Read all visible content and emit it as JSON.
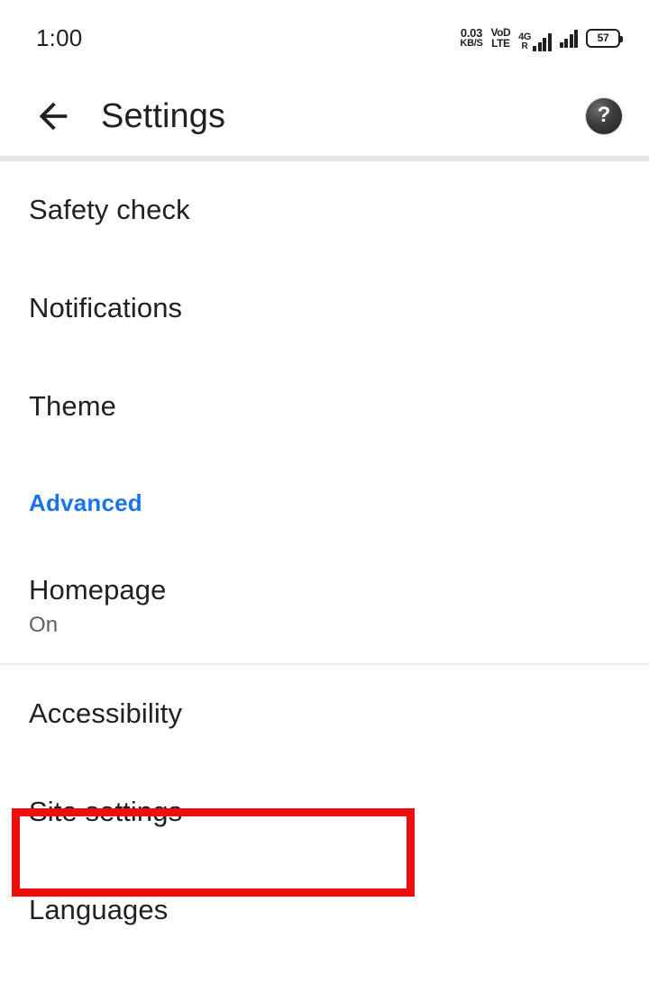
{
  "status_bar": {
    "clock": "1:00",
    "net_speed_value": "0.03",
    "net_speed_unit": "KB/S",
    "volte_top": "VoD",
    "volte_bottom": "LTE",
    "network_type": "4G",
    "roaming": "R",
    "battery_percent": "57"
  },
  "toolbar": {
    "title": "Settings",
    "back_icon": "back-arrow-icon",
    "help_icon": "help-question-icon",
    "help_glyph": "?"
  },
  "list": {
    "items": [
      {
        "title": "Safety check",
        "subtitle": ""
      },
      {
        "title": "Notifications",
        "subtitle": ""
      },
      {
        "title": "Theme",
        "subtitle": ""
      },
      {
        "title": "Advanced",
        "subtitle": ""
      },
      {
        "title": "Homepage",
        "subtitle": "On"
      },
      {
        "title": "Accessibility",
        "subtitle": ""
      },
      {
        "title": "Site settings",
        "subtitle": ""
      },
      {
        "title": "Languages",
        "subtitle": ""
      }
    ]
  },
  "annotation": {
    "target_label": "Site settings",
    "color": "#f20d0d"
  },
  "colors": {
    "accent_blue": "#1a73e8",
    "text_primary": "#202124",
    "text_secondary": "#5f6368",
    "divider": "#e8eaed",
    "section_divider": "#e4e4e4",
    "background": "#ffffff"
  }
}
